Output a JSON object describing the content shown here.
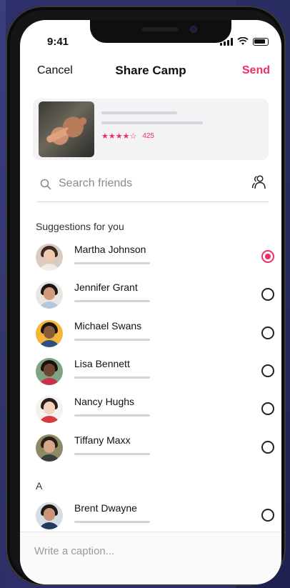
{
  "status": {
    "time": "9:41"
  },
  "nav": {
    "cancel": "Cancel",
    "title": "Share Camp",
    "send": "Send"
  },
  "camp": {
    "rating_stars": "★★★★☆",
    "rating_count": "425",
    "rating_value": 4,
    "rating_max": 5
  },
  "search": {
    "placeholder": "Search friends"
  },
  "sections": {
    "suggestions": "Suggestions for you",
    "a": "A"
  },
  "friends": [
    {
      "name": "Martha Johnson",
      "selected": true
    },
    {
      "name": "Jennifer Grant",
      "selected": false
    },
    {
      "name": "Michael Swans",
      "selected": false
    },
    {
      "name": "Lisa Bennett",
      "selected": false
    },
    {
      "name": "Nancy Hughs",
      "selected": false
    },
    {
      "name": "Tiffany Maxx",
      "selected": false
    },
    {
      "name": "Brent Dwayne",
      "selected": false
    }
  ],
  "caption": {
    "placeholder": "Write a caption..."
  },
  "colors": {
    "accent": "#ef2f64"
  }
}
